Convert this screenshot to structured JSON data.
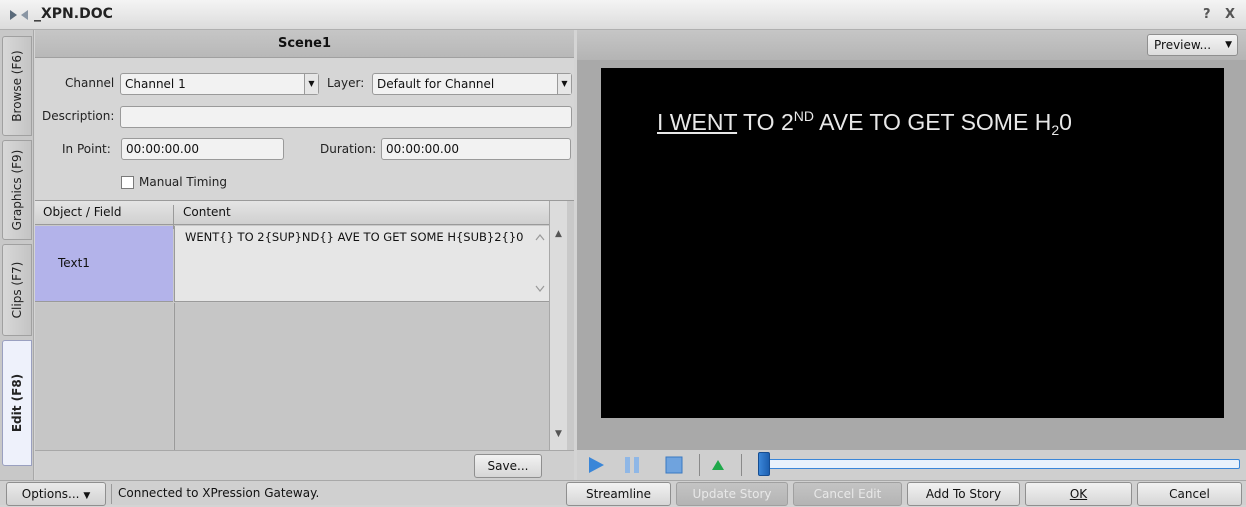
{
  "window": {
    "title": "_XPN.DOC",
    "help": "?",
    "close": "X"
  },
  "side_tabs": [
    {
      "label": "Browse (F6)"
    },
    {
      "label": "Graphics (F9)"
    },
    {
      "label": "Clips (F7)"
    },
    {
      "label": "Edit (F8)"
    }
  ],
  "scene": {
    "title": "Scene1",
    "channel_label": "Channel",
    "channel_value": "Channel 1",
    "layer_label": "Layer:",
    "layer_value": "Default for Channel",
    "description_label": "Description:",
    "description_value": "",
    "in_point_label": "In Point:",
    "in_point_value": "00:00:00.00",
    "duration_label": "Duration:",
    "duration_value": "00:00:00.00",
    "manual_timing_label": "Manual Timing",
    "manual_timing_checked": false
  },
  "grid": {
    "headers": [
      "Object / Field",
      "Content"
    ],
    "rows": [
      {
        "name": "Text1",
        "content": "WENT{} TO 2{SUP}ND{} AVE TO GET SOME H{SUB}2{}0"
      }
    ]
  },
  "left_bottom": {
    "save_label": "Save..."
  },
  "preview": {
    "button_label": "Preview...",
    "render": {
      "underlined": "I WENT",
      "part1": " TO 2",
      "sup": "ND",
      "part2": " AVE TO GET SOME H",
      "sub": "2",
      "part3": "0"
    }
  },
  "transport": {
    "position": 0.0
  },
  "status": {
    "options_label": "Options...",
    "message": "Connected to XPression Gateway."
  },
  "footer_buttons": {
    "streamline": "Streamline",
    "update_story": "Update Story",
    "cancel_edit": "Cancel Edit",
    "add_to_story": "Add To Story",
    "ok": "OK",
    "cancel": "Cancel"
  },
  "colors": {
    "selected_row": "#b3b3ea",
    "accent_blue": "#3a86d8",
    "play_green": "#1fa84a"
  }
}
